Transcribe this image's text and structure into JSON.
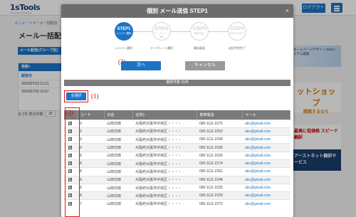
{
  "background": {
    "logo": "1sTools",
    "logo_sub": "web system production",
    "login_label": "ログアウト",
    "breadcrumb": {
      "home": "メニュー",
      "sep": " > ",
      "current": "メール一括配信"
    },
    "title": "メール一括配信",
    "group_button": "メール配信(グループ別)",
    "search_header": "検索+",
    "date_header": "配信日",
    "dates": [
      "2015/07/13 11:21",
      "2015/07/15 11:57"
    ],
    "count_text": "全 2件 表示件数",
    "count_value": "20",
    "ads": {
      "ad1": "ホームページデザイン Webシステム開発",
      "ad2_title": "ットショップ",
      "ad2_sub": "開業するなら",
      "ad3": "最高に低価格 スピード翻訳",
      "ad4": "アーストネット翻訳サービス"
    }
  },
  "modal": {
    "title": "個別 メール送信 STEP1",
    "close": "×",
    "steps": [
      {
        "num": "STEP1",
        "sub": "メンバー選択",
        "caption": "メンバー選択",
        "active": true
      },
      {
        "num": "STEP2",
        "sub": "テンプレート選択",
        "caption": "テンプレート選択",
        "active": false
      },
      {
        "num": "STEP3",
        "sub": "確認画面",
        "caption": "確認画面",
        "active": false
      },
      {
        "num": "STEP4",
        "sub": "送信予約完了",
        "caption": "送信予約完了",
        "active": false
      }
    ],
    "next_label": "次へ",
    "cancel_label": "キャンセル",
    "selected_count": "選択件数 20件",
    "select_all_label": "全選択",
    "annotations": {
      "a1": "(1)",
      "a2": "(2)",
      "a3": "(3)"
    },
    "table": {
      "headers": [
        "",
        "コード",
        "氏名",
        "住所1",
        "携帯電話",
        "メール"
      ],
      "rows": [
        [
          "9",
          "山田次郎",
          "大阪府大阪市中央区・・・・",
          "090-1111-2275",
          "abc@gmail.com"
        ],
        [
          "9",
          "山田次郎",
          "大阪府大阪市中央区・・・・",
          "090-1111-2262",
          "abc@gmail.com"
        ],
        [
          "9",
          "山田次郎",
          "大阪府大阪市中央区・・・・",
          "090-1111-2249",
          "abc@gmail.com"
        ],
        [
          "9",
          "山田次郎",
          "大阪府大阪市中央区・・・・",
          "090-1111-2236",
          "abc@gmail.com"
        ],
        [
          "8",
          "山田次郎",
          "大阪府大阪市中央区・・・・",
          "090-1111-2230",
          "abc@gmail.com"
        ],
        [
          "8",
          "山田次郎",
          "大阪府大阪市中央区・・・・",
          "090-1111-2274",
          "abc@gmail.com"
        ],
        [
          "8",
          "山田次郎",
          "大阪府大阪市中央区・・・・",
          "090-1111-2261",
          "abc@gmail.com"
        ],
        [
          "8",
          "山田次郎",
          "大阪府大阪市中央区・・・・",
          "090-1111-2248",
          "abc@gmail.com"
        ],
        [
          "8",
          "山田次郎",
          "大阪府大阪市中央区・・・・",
          "090-1111-2235",
          "abc@gmail.com"
        ],
        [
          "8",
          "山田次郎",
          "大阪府大阪市中央区・・・・",
          "090-1111-2229",
          "abc@gmail.com"
        ],
        [
          "7",
          "山田次郎",
          "大阪府大阪市中央区・・・・",
          "090-1111-2272",
          "abc@gmail.com"
        ]
      ]
    }
  },
  "colors": {
    "accent": "#1d74c5",
    "header_gray": "#6c6c6c",
    "annotation": "#cc1111"
  }
}
